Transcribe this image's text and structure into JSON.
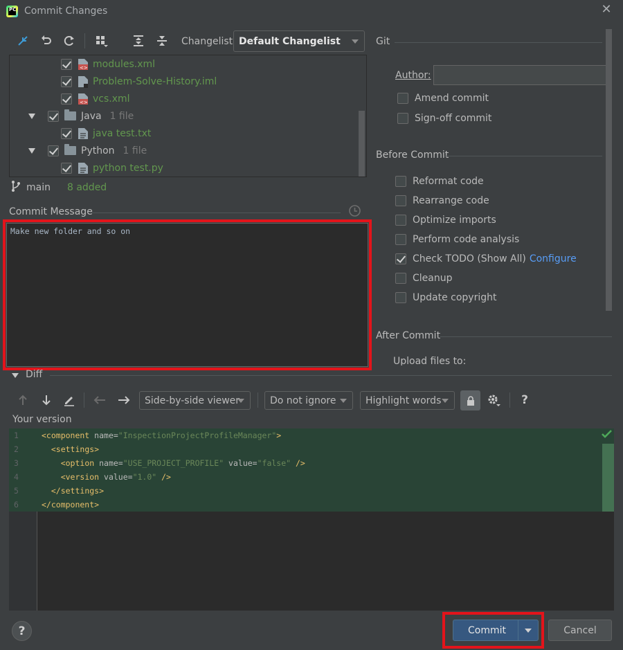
{
  "window": {
    "title": "Commit Changes"
  },
  "toolbar": {
    "changelist_label": "Changelist:",
    "changelist_value": "Default Changelist"
  },
  "tree": {
    "items": [
      {
        "label": "modules.xml",
        "type": "file",
        "icon": "xml-file-icon"
      },
      {
        "label": "Problem-Solve-History.iml",
        "type": "file",
        "icon": "iml-file-icon"
      },
      {
        "label": "vcs.xml",
        "type": "file",
        "icon": "xml-file-icon"
      },
      {
        "label": "Java",
        "count": "1 file",
        "type": "folder"
      },
      {
        "label": "java test.txt",
        "type": "file",
        "icon": "text-file-icon"
      },
      {
        "label": "Python",
        "count": "1 file",
        "type": "folder"
      },
      {
        "label": "python test.py",
        "type": "file",
        "icon": "text-file-icon"
      }
    ]
  },
  "status": {
    "branch": "main",
    "added": "8 added"
  },
  "commit_message": {
    "label": "Commit Message",
    "text": "Make new folder and so on"
  },
  "git": {
    "title": "Git",
    "author_label": "Author:",
    "author_value": "",
    "amend": "Amend commit",
    "signoff": "Sign-off commit"
  },
  "before_commit": {
    "title": "Before Commit",
    "reformat": "Reformat code",
    "rearrange": "Rearrange code",
    "optimize": "Optimize imports",
    "analysis": "Perform code analysis",
    "todo": "Check TODO (Show All)",
    "todo_link": "Configure",
    "cleanup": "Cleanup",
    "copyright": "Update copyright"
  },
  "after_commit": {
    "title": "After Commit",
    "upload": "Upload files to:"
  },
  "diff": {
    "title": "Diff",
    "viewer": "Side-by-side viewer",
    "ignore": "Do not ignore",
    "highlight": "Highlight words",
    "your_version": "Your version",
    "lines": [
      {
        "n": "1",
        "indent": "",
        "tag": "component",
        "attrs": [
          [
            "name",
            "\"InspectionProjectProfileManager\""
          ]
        ],
        "close": ">"
      },
      {
        "n": "2",
        "indent": "  ",
        "tag": "settings",
        "attrs": [],
        "close": ">"
      },
      {
        "n": "3",
        "indent": "    ",
        "tag": "option",
        "attrs": [
          [
            "name",
            "\"USE_PROJECT_PROFILE\""
          ],
          [
            "value",
            "\"false\""
          ]
        ],
        "close": " />"
      },
      {
        "n": "4",
        "indent": "    ",
        "tag": "version",
        "attrs": [
          [
            "value",
            "\"1.0\""
          ]
        ],
        "close": " />"
      },
      {
        "n": "5",
        "indent": "  ",
        "tag": "/settings",
        "attrs": [],
        "close": ">"
      },
      {
        "n": "6",
        "indent": "",
        "tag": "/component",
        "attrs": [],
        "close": ">"
      }
    ]
  },
  "buttons": {
    "commit": "Commit",
    "cancel": "Cancel",
    "help": "?"
  },
  "colors": {
    "accent_red": "#e3141b",
    "primary": "#365880",
    "link": "#589df6",
    "added": "#62974e"
  }
}
